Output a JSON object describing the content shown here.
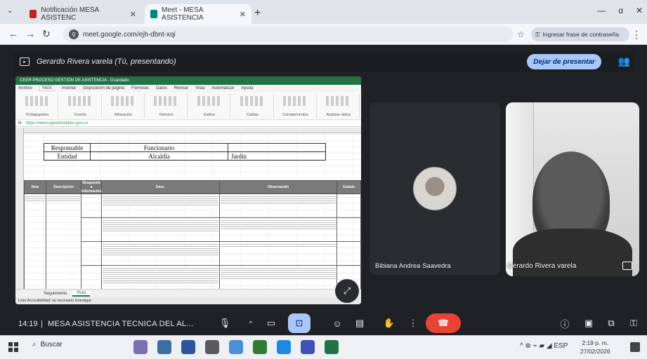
{
  "browser": {
    "tab_menu": "⌄",
    "tabs": [
      {
        "label": "Notificación MESA ASISTENC",
        "close": "✕",
        "fav_color": "#c5221f"
      },
      {
        "label": "Meet - MESA ASISTENCIA",
        "close": "✕",
        "fav_color": "#00897b"
      }
    ],
    "new_tab": "+",
    "window_controls": [
      "—",
      "ɑ",
      "✕"
    ],
    "url": "meet.google.com/ejh-dbnt-xqi",
    "password_chip": "Ingresar frase de contraseña"
  },
  "meet": {
    "presenting_text": "Gerardo Rivera varela (Tú, presentando)",
    "stop_presenting": "Dejar de presentar",
    "participants": [
      {
        "name": "Bibiana Andrea Saavedra"
      },
      {
        "name": "Gerardo Rivera varela"
      }
    ],
    "clock": "14:19",
    "separator": "|",
    "meeting_title": "MESA ASISTENCIA TECNICA DEL AL...",
    "icons": {
      "mic": "🎙",
      "more_arrow": "^",
      "camera": "▭",
      "present": "⊡",
      "emoji": "☺",
      "captions": "▤",
      "hand": "✋",
      "more": "⋮",
      "leave": "☎",
      "info": "ⓘ",
      "chat": "▣",
      "activities": "⧉",
      "host": "⚿",
      "expand": "⤢",
      "people": "👥"
    }
  },
  "excel": {
    "title": "CEER PROCESO GESTIÓN DE ASISTENCIA - Guardado",
    "tabs": [
      "Archivo",
      "Inicio",
      "Insertar",
      "Disposición de página",
      "Fórmulas",
      "Datos",
      "Revisar",
      "Vista",
      "Automatizar",
      "Ayuda"
    ],
    "active_tab": "Inicio",
    "ribbon_groups": [
      "Portapapeles",
      "Fuente",
      "Alineación",
      "Número",
      "Estilos",
      "Celdas",
      "Complementos",
      "Analizar datos"
    ],
    "formula_value": "https://www.ugestiondatos.gov.co",
    "info_rows": [
      {
        "label": "Responsable",
        "value": "Funcionario",
        "extra": ""
      },
      {
        "label": "Entidad",
        "value": "Alcaldía",
        "extra": "Jardín"
      }
    ],
    "table_headers": [
      "Ítem",
      "Descripción",
      "Respuesta a información",
      "Desc.",
      "Observación",
      "Estado"
    ],
    "sheet_tabs": [
      "Seguimiento",
      "Ruta"
    ],
    "active_sheet": "Ruta",
    "status": "Listo   Accesibilidad: es necesario investigar"
  },
  "taskbar": {
    "search": "Buscar",
    "search_icon": "⌕",
    "tray": "^ ⊕ ⌁ ▰ ◢ ESP",
    "time": "2:19 p. m.",
    "date": "27/02/2026",
    "app_icon_colors": [
      "#7a6fb0",
      "#3a6ea5",
      "#2b579a",
      "#5a5a5a",
      "#4a90d9",
      "#2e7d32",
      "#1e88e5",
      "#3f51b5",
      "#217346"
    ]
  }
}
